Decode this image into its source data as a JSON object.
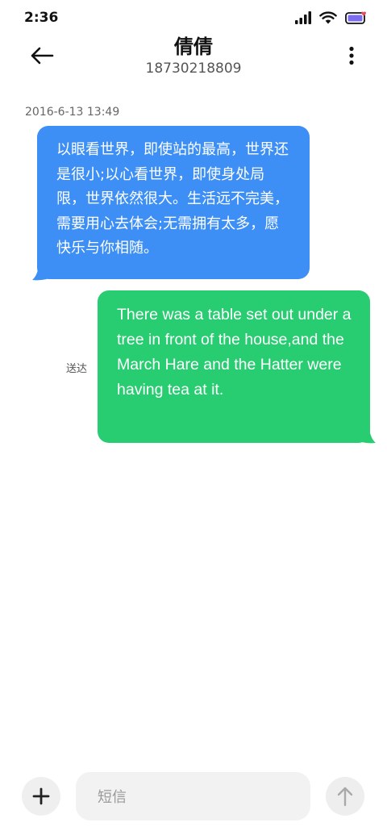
{
  "status_bar": {
    "time": "2:36"
  },
  "header": {
    "contact_name": "倩倩",
    "contact_number": "18730218809"
  },
  "conversation": {
    "timestamp": "2016-6-13 13:49",
    "incoming_message": "以眼看世界，即使站的最高，世界还是很小;以心看世界，即使身处局限，世界依然很大。生活远不完美，需要用心去体会;无需拥有太多，愿快乐与你相随。",
    "outgoing_message": "There was a table set out under a tree in front of the house,and the March Hare and the Hatter were having tea at it.",
    "delivered_label": "送达"
  },
  "composer": {
    "placeholder": "短信"
  },
  "colors": {
    "incoming_bubble": "#3d8ff5",
    "outgoing_bubble": "#27cd70",
    "battery_heart": "#e54b5b"
  },
  "icons": {
    "back": "arrow-left-icon",
    "more": "vertical-dots-icon",
    "add": "plus-icon",
    "send": "arrow-up-icon"
  }
}
